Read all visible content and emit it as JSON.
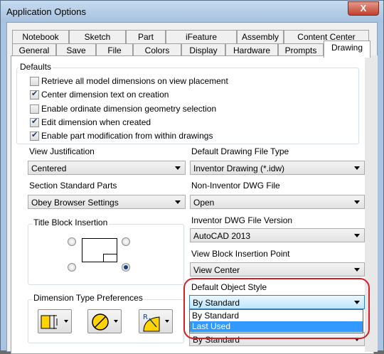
{
  "window": {
    "title": "Application Options",
    "close_label": "X"
  },
  "tabs_row1": [
    "Notebook",
    "Sketch",
    "Part",
    "iFeature",
    "Assembly",
    "Content Center"
  ],
  "tabs_row2": [
    "General",
    "Save",
    "File",
    "Colors",
    "Display",
    "Hardware",
    "Prompts",
    "Drawing"
  ],
  "active_tab": "Drawing",
  "defaults": {
    "label": "Defaults",
    "checkboxes": [
      {
        "label": "Retrieve all model dimensions on view placement",
        "checked": false
      },
      {
        "label": "Center dimension text on creation",
        "checked": true
      },
      {
        "label": "Enable ordinate dimension geometry selection",
        "checked": false
      },
      {
        "label": "Edit dimension when created",
        "checked": true
      },
      {
        "label": "Enable part modification from within drawings",
        "checked": true
      }
    ]
  },
  "view_justification": {
    "label": "View Justification",
    "value": "Centered"
  },
  "default_drawing_file_type": {
    "label": "Default Drawing File Type",
    "value": "Inventor Drawing (*.idw)"
  },
  "section_standard_parts": {
    "label": "Section Standard Parts",
    "value": "Obey Browser Settings"
  },
  "non_inventor_dwg_file": {
    "label": "Non-Inventor DWG File",
    "value": "Open"
  },
  "inventor_dwg_file_version": {
    "label": "Inventor DWG File Version",
    "value": "AutoCAD 2013"
  },
  "view_block_insertion_point": {
    "label": "View Block Insertion Point",
    "value": "View Center"
  },
  "title_block_insertion": {
    "label": "Title Block Insertion",
    "selected_corner": "bottom-right"
  },
  "dimension_type_preferences": {
    "label": "Dimension Type Preferences"
  },
  "default_object_style": {
    "label": "Default Object Style",
    "value": "By Standard",
    "options": [
      "By Standard",
      "Last Used"
    ],
    "highlighted_option": "Last Used"
  },
  "below_combo_value": "By Standard"
}
